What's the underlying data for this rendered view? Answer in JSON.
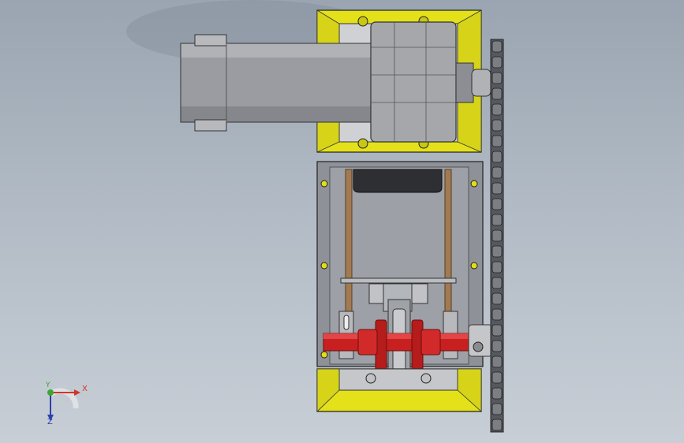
{
  "view": {
    "background_top": "#9aa5b1",
    "background_bottom": "#c7ced6"
  },
  "colors": {
    "frame_yellow": "#e4e11a",
    "metal_gray": "#8e9198",
    "motor_gray": "#9a9ca1",
    "shaft_red": "#c82020",
    "rod_bronze": "#a07a52",
    "chain_dark": "#3a3c40"
  },
  "triad": {
    "x_label": "X",
    "y_label": "Y",
    "z_label": "Z",
    "x_color": "#d4342a",
    "y_color": "#3ba535",
    "z_color": "#2a3fb0"
  },
  "icons": {
    "axis_triad": "orientation-triad-icon"
  }
}
